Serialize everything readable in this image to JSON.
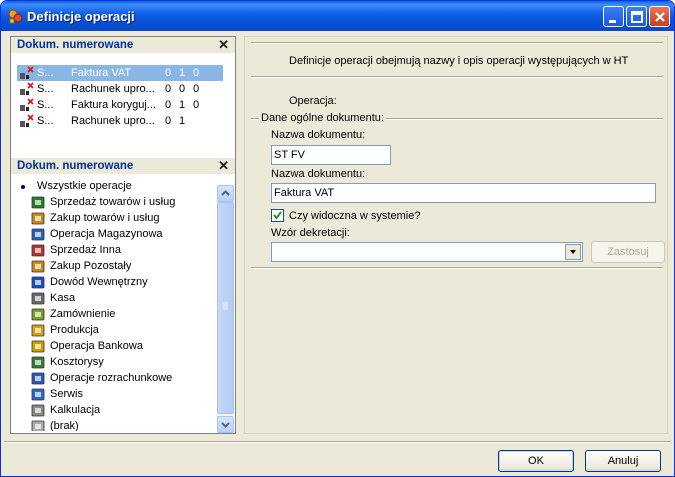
{
  "window": {
    "title": "Definicje operacji"
  },
  "documents_pane": {
    "header": "Dokum. numerowane",
    "close_glyph": "✕",
    "rows": [
      {
        "c1": "S...",
        "name": "Faktura VAT",
        "v1": "0",
        "v2": "1",
        "v3": "0",
        "selected": true
      },
      {
        "c1": "S...",
        "name": "Rachunek upro...",
        "v1": "0",
        "v2": "0",
        "v3": "0",
        "selected": false
      },
      {
        "c1": "S...",
        "name": "Faktura koryguj...",
        "v1": "0",
        "v2": "1",
        "v3": "0",
        "selected": false
      },
      {
        "c1": "S...",
        "name": "Rachunek upro...",
        "v1": "0",
        "v2": "1",
        "v3": "",
        "selected": false
      }
    ]
  },
  "operations_pane": {
    "header": "Dokum. numerowane",
    "close_glyph": "✕",
    "root": "Wszystkie operacje",
    "items": [
      {
        "label": "Sprzedaż towarów i usług",
        "icon": "sales-icon"
      },
      {
        "label": "Zakup towarów i usług",
        "icon": "purchase-icon"
      },
      {
        "label": "Operacja Magazynowa",
        "icon": "warehouse-icon"
      },
      {
        "label": "Sprzedaż Inna",
        "icon": "other-sales-icon"
      },
      {
        "label": "Zakup Pozostały",
        "icon": "other-purchase-icon"
      },
      {
        "label": "Dowód Wewnętrzny",
        "icon": "internal-document-icon"
      },
      {
        "label": "Kasa",
        "icon": "cash-register-icon"
      },
      {
        "label": "Zamównienie",
        "icon": "order-icon"
      },
      {
        "label": "Produkcja",
        "icon": "production-gear-icon"
      },
      {
        "label": "Operacja Bankowa",
        "icon": "bank-icon"
      },
      {
        "label": "Kosztorysy",
        "icon": "cost-estimate-chart-icon"
      },
      {
        "label": "Operacje rozrachunkowe",
        "icon": "settlement-icon"
      },
      {
        "label": "Serwis",
        "icon": "service-icon"
      },
      {
        "label": "Kalkulacja",
        "icon": "calculator-icon"
      },
      {
        "label": "(brak)",
        "icon": "none-icon"
      }
    ]
  },
  "details": {
    "description": "Definicje operacji obejmują nazwy i opis operacji występujących w HT",
    "operation_label": "Operacja:",
    "group_label": "Dane ogólne dokumentu:",
    "short_name_label": "Nazwa dokumentu:",
    "short_name_value": "ST FV",
    "name_label": "Nazwa dokumentu:",
    "name_value": "Faktura VAT",
    "visible_label": "Czy widoczna w systemie?",
    "visible_checked": true,
    "posting_label": "Wzór dekretacji:",
    "posting_value": "",
    "apply_button": "Zastosuj"
  },
  "footer": {
    "ok": "OK",
    "cancel": "Anuluj"
  }
}
